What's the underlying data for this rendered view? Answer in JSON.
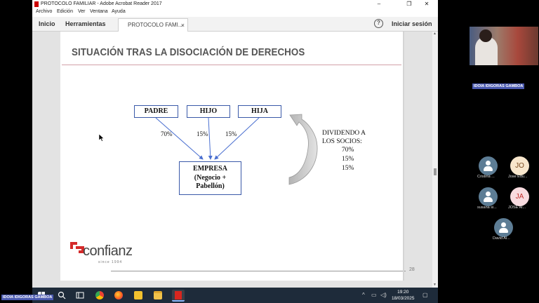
{
  "window": {
    "title": "PROTOCOLO FAMILIAR - Adobe Acrobat Reader 2017",
    "minimize": "–",
    "maximize": "❐",
    "close": "✕"
  },
  "menu": [
    "Archivo",
    "Edición",
    "Ver",
    "Ventana",
    "Ayuda"
  ],
  "toolbar": {
    "home": "Inicio",
    "tools": "Herramientas",
    "doc_tab": "PROTOCOLO FAMI...",
    "doc_tab_close": "×",
    "help": "?",
    "signin": "Iniciar sesión"
  },
  "slide": {
    "title": "SITUACIÓN TRAS LA DISOCIACIÓN DE DERECHOS",
    "boxes": {
      "padre": "PADRE",
      "hijo": "HIJO",
      "hija": "HIJA"
    },
    "empresa": [
      "EMPRESA",
      "(Negocio +",
      "Pabellón)"
    ],
    "percents": {
      "padre": "70%",
      "hijo": "15%",
      "hija": "15%"
    },
    "dividend": {
      "line1": "DIVIDENDO A",
      "line2": "LOS SOCIOS:",
      "values": [
        "70%",
        "15%",
        "15%"
      ]
    },
    "logo_word": "confianz",
    "logo_tagline": "since 1994",
    "page_number": "28"
  },
  "taskbar": {
    "time": "19:20",
    "date": "18/03/2025"
  },
  "meeting": {
    "presenter_label": "IDOIA IDIGORAS GAMBOA",
    "presenter_label_bottom": "IDOIA IDIGORAS GAMBOA",
    "participants": [
      {
        "name": "Cristina ...",
        "initials": ""
      },
      {
        "name": "Jose Edu...",
        "initials": "JO"
      },
      {
        "name": "susana si...",
        "initials": ""
      },
      {
        "name": "JOSE Al...",
        "initials": "JA"
      },
      {
        "name": "David Al...",
        "initials": ""
      }
    ]
  },
  "colors": {
    "box_border": "#3a59a8",
    "arrow": "#4a6fd0",
    "logo_red": "#d42a2a",
    "taskbar": "#1e2b3a",
    "name_chip": "#4b5ab0"
  }
}
